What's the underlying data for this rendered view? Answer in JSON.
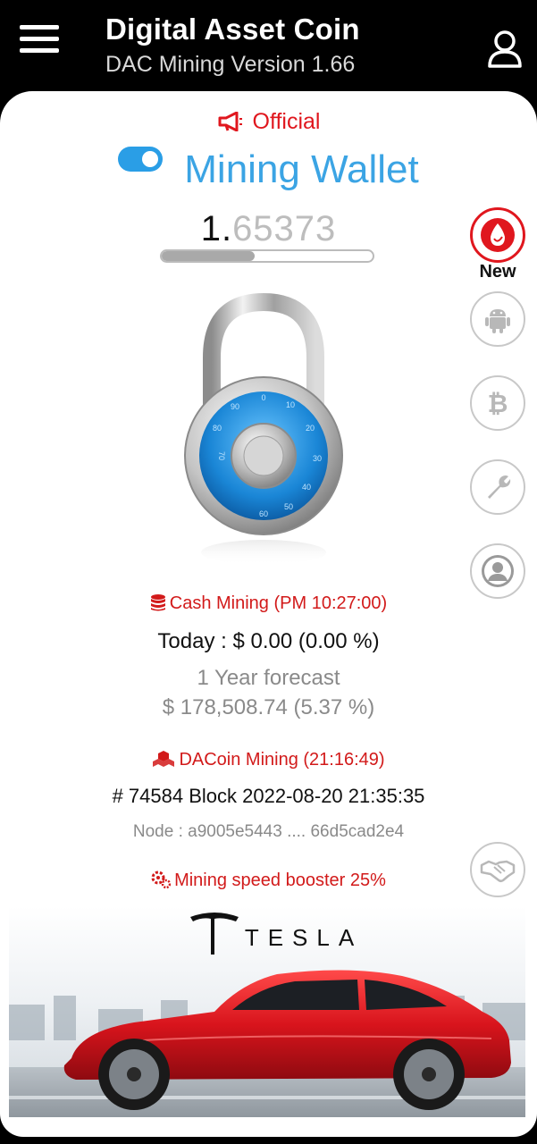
{
  "header": {
    "title": "Digital Asset Coin",
    "subtitle": "DAC Mining Version 1.66"
  },
  "official_label": "Official",
  "wallet": {
    "title": "Mining Wallet",
    "toggle_on": true,
    "balance_int": "1.",
    "balance_dec": "65373",
    "progress": 0.44
  },
  "side_buttons": [
    {
      "icon": "new-app-icon",
      "badge": "New"
    },
    {
      "icon": "android-icon"
    },
    {
      "icon": "bitcoin-icon"
    },
    {
      "icon": "wrench-icon"
    },
    {
      "icon": "profile-icon"
    },
    {
      "icon": "handshake-icon"
    }
  ],
  "cash": {
    "label": "Cash Mining (PM 10:27:00)",
    "today": "Today : $ 0.00 (0.00 %)",
    "forecast_label": "1 Year forecast",
    "forecast_value": "$ 178,508.74 (5.37 %)"
  },
  "dacoin": {
    "label": "DACoin Mining (21:16:49)",
    "block": "# 74584 Block 2022-08-20 21:35:35",
    "node": "Node : a9005e5443 .... 66d5cad2e4"
  },
  "booster_label": "Mining speed booster 25%",
  "banner": {
    "brand": "TESLA"
  },
  "colors": {
    "accent_red": "#e0171e",
    "accent_blue": "#3ba4e4"
  }
}
